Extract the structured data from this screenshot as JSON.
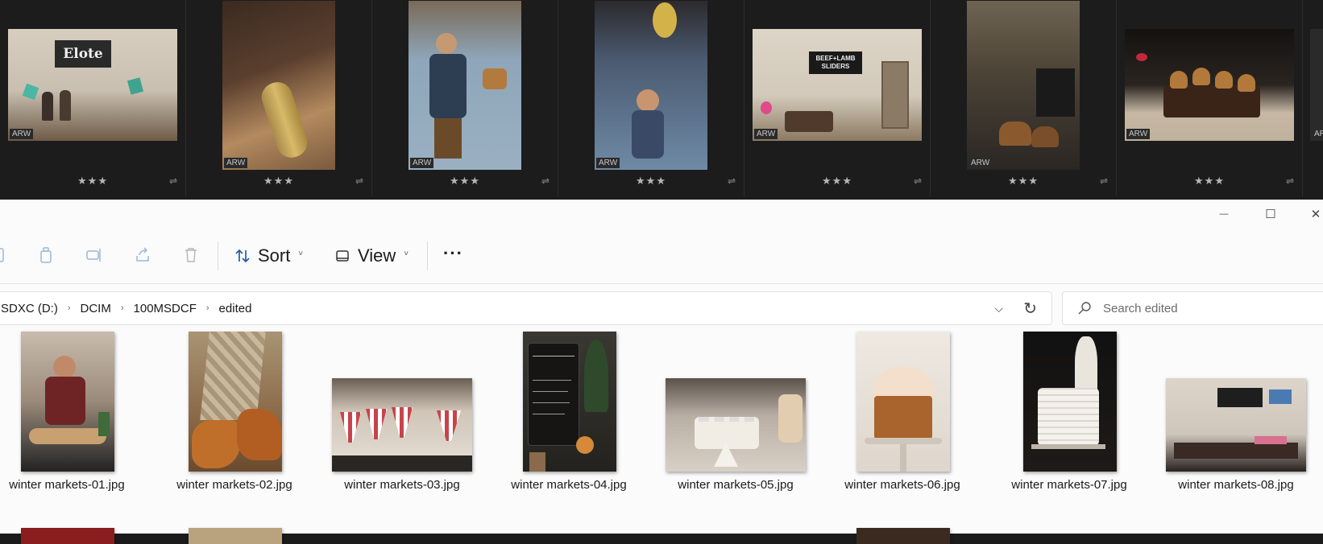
{
  "filmstrip": {
    "items": [
      {
        "badge": "ARW",
        "rating": "★★★",
        "bg": "#cfc6b8",
        "accent": "#2a2a2a"
      },
      {
        "badge": "ARW",
        "rating": "★★★",
        "bg": "#5a3f2e",
        "accent": "#c99a4a"
      },
      {
        "badge": "ARW",
        "rating": "★★★",
        "bg": "#8aa3b8",
        "accent": "#6b4a2a"
      },
      {
        "badge": "ARW",
        "rating": "★★★",
        "bg": "#5c6e86",
        "accent": "#d4b24a"
      },
      {
        "badge": "ARW",
        "rating": "★★★",
        "bg": "#d8d0c2",
        "accent": "#1a1a1a"
      },
      {
        "badge": "ARW",
        "rating": "★★★",
        "bg": "#6b5e4e",
        "accent": "#2b2b2b"
      },
      {
        "badge": "ARW",
        "rating": "★★★",
        "bg": "#1e1a17",
        "accent": "#b2793b"
      },
      {
        "badge": "ARW",
        "rating": "",
        "bg": "#1e1e1e",
        "accent": "#555"
      }
    ],
    "text_in_photos": {
      "photo1_sign": "Elote",
      "photo5_sign": "BEEF+LAMB SLIDERS"
    }
  },
  "window": {
    "minimize": "—",
    "maximize": "☐",
    "close": "✕"
  },
  "toolbar": {
    "sort_label": "Sort",
    "view_label": "View",
    "more_label": "···",
    "chevron": "˅"
  },
  "address": {
    "crumbs": [
      "SDXC (D:)",
      "DCIM",
      "100MSDCF",
      "edited"
    ],
    "separator": "›",
    "dropdown": "⌵",
    "refresh": "↻"
  },
  "search": {
    "placeholder": "Search edited"
  },
  "files": [
    {
      "name": "winter markets-01.jpg",
      "bg": "#3f2a22",
      "accent": "#8b3a2e"
    },
    {
      "name": "winter markets-02.jpg",
      "bg": "#b59b75",
      "accent": "#c06f2b"
    },
    {
      "name": "winter markets-03.jpg",
      "bg": "#d9cfc3",
      "accent": "#c9434a"
    },
    {
      "name": "winter markets-04.jpg",
      "bg": "#2b2a26",
      "accent": "#b98a3f"
    },
    {
      "name": "winter markets-05.jpg",
      "bg": "#c9bfb5",
      "accent": "#f4f0ea"
    },
    {
      "name": "winter markets-06.jpg",
      "bg": "#eae3dc",
      "accent": "#b6743a"
    },
    {
      "name": "winter markets-07.jpg",
      "bg": "#1a1614",
      "accent": "#f4f1ec"
    },
    {
      "name": "winter markets-08.jpg",
      "bg": "#d5ccc2",
      "accent": "#2a2220"
    }
  ],
  "next_row_peek": [
    {
      "bg": "#8a1d1d"
    },
    {
      "bg": "#b9a37f"
    },
    {
      "bg": "#3a2a1f"
    }
  ]
}
